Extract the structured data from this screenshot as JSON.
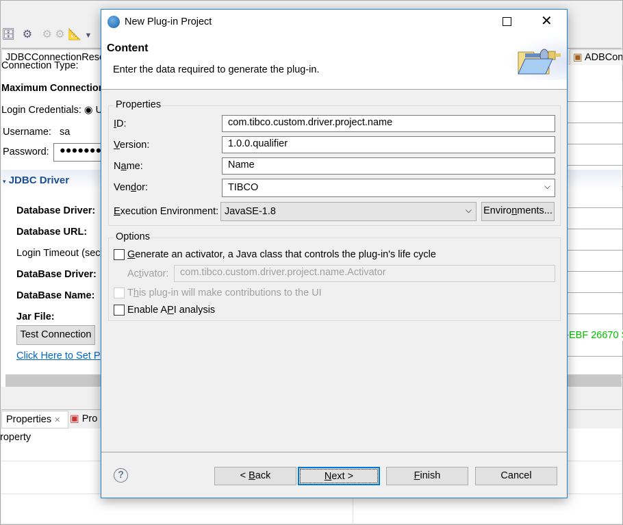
{
  "background": {
    "editor_tab": "JDBCConnectionResc",
    "right_tab": "ADBCon",
    "rows": {
      "connection_type": "Connection Type:",
      "max_conn": "Maximum Connection",
      "login_credentials": "Login Credentials:",
      "radio_u": "U",
      "username_label": "Username:",
      "username_value": "sa",
      "password_label": "Password:",
      "password_value": "●●●●●●●"
    },
    "section_title": "JDBC Driver",
    "driver_rows": [
      "Database Driver:",
      "Database URL:",
      "Login Timeout (sec",
      "DataBase Driver:",
      "DataBase Name:",
      "Jar File:"
    ],
    "test_button": "Test Connection",
    "link": "Click Here to Set P",
    "green_text": "EBF 26670 S",
    "bottom_tabs": [
      "Properties",
      "Pro"
    ],
    "property_text": "roperty"
  },
  "dialog": {
    "title": "New Plug-in Project",
    "header_title": "Content",
    "header_desc": "Enter the data required to generate the plug-in.",
    "properties": {
      "group_label": "Properties",
      "id": {
        "label_pre": "",
        "label_key": "I",
        "label_post": "D:",
        "value": "com.tibco.custom.driver.project.name"
      },
      "version": {
        "label_pre": "",
        "label_key": "V",
        "label_post": "ersion:",
        "value": "1.0.0.qualifier"
      },
      "name": {
        "label_pre": "N",
        "label_key": "a",
        "label_post": "me:",
        "value": "Name"
      },
      "vendor": {
        "label_pre": "Ven",
        "label_key": "d",
        "label_post": "or:",
        "value": "TIBCO"
      },
      "exec_env": {
        "label_pre": "",
        "label_key": "E",
        "label_post": "xecution Environment:",
        "value": "JavaSE-1.8",
        "button_pre": "Enviro",
        "button_key": "n",
        "button_post": "ments..."
      }
    },
    "options": {
      "group_label": "Options",
      "activator_cb": {
        "pre": "",
        "key": "G",
        "post": "enerate an activator, a Java class that controls the plug-in's life cycle",
        "checked": false
      },
      "activator": {
        "pre": "Ac",
        "key": "t",
        "post": "ivator:",
        "value": "com.tibco.custom.driver.project.name.Activator"
      },
      "ui_cb": {
        "pre": "T",
        "key": "h",
        "post": "is plug-in will make contributions to the UI",
        "checked": false
      },
      "api_cb": {
        "pre": "Enable A",
        "key": "P",
        "post": "I analysis",
        "checked": false
      }
    },
    "buttons": {
      "back": {
        "pre": "< ",
        "key": "B",
        "post": "ack"
      },
      "next": {
        "pre": "",
        "key": "N",
        "post": "ext >"
      },
      "finish": {
        "pre": "",
        "key": "F",
        "post": "inish"
      },
      "cancel": "Cancel"
    }
  }
}
